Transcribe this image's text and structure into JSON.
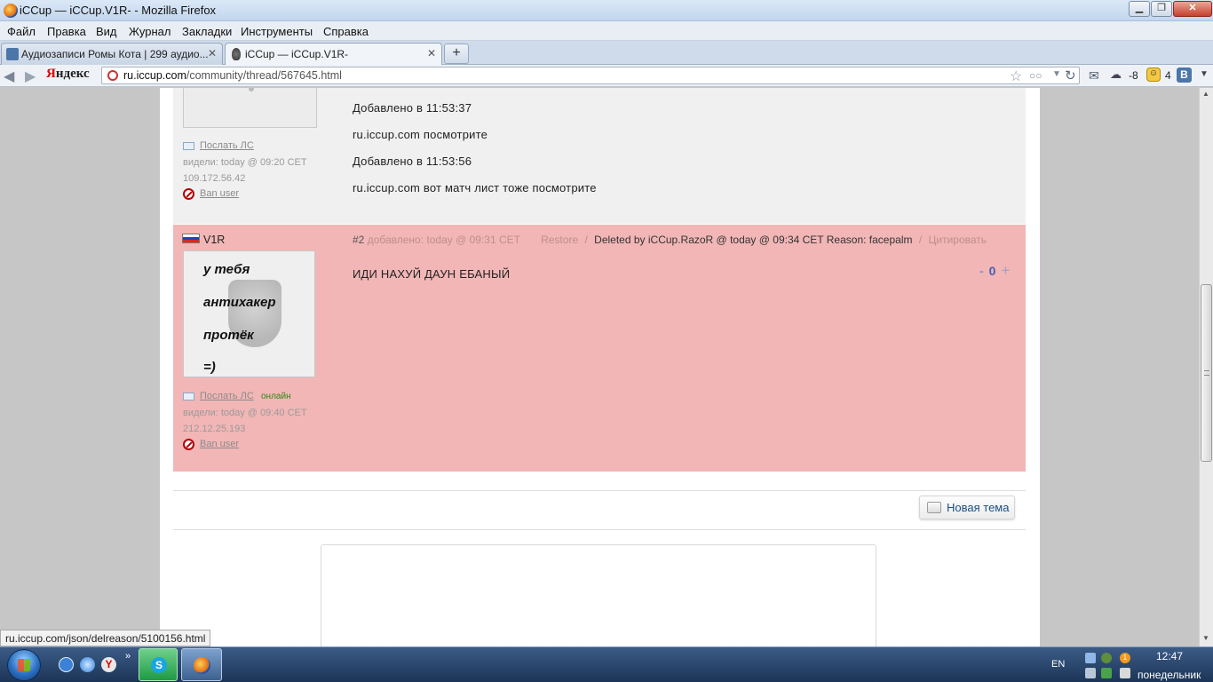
{
  "window": {
    "title": "iCCup — iCCup.V1R- - Mozilla Firefox",
    "min_glyph": "▁",
    "max_glyph": "❐",
    "close_glyph": "✕"
  },
  "menu": [
    "Файл",
    "Правка",
    "Вид",
    "Журнал",
    "Закладки",
    "Инструменты",
    "Справка"
  ],
  "tabs": [
    {
      "label": "Аудиозаписи Ромы Кота | 299 аудио...",
      "active": false
    },
    {
      "label": "iCCup — iCCup.V1R-",
      "active": true
    }
  ],
  "tab_close_glyph": "✕",
  "new_tab_glyph": "+",
  "nav": {
    "back_glyph": "◀",
    "fwd_glyph": "▶",
    "yandex_first": "Я",
    "yandex_rest": "ндекс",
    "url_domain": "ru.iccup.com",
    "url_path": "/community/thread/567645.html",
    "weather": "-8",
    "notification_count": "4",
    "vk": "В"
  },
  "post1": {
    "send_pm": "Послать ЛС",
    "seen": "видели: today @ 09:20 CET",
    "ip": "109.172.56.42",
    "ban": "Ban user",
    "lines": [
      "Добавлено в 11:53:37",
      "ru.iccup.com посмотрите",
      "Добавлено в 11:53:56",
      "ru.iccup.com вот матч лист тоже посмотрите"
    ]
  },
  "post2": {
    "username": "V1R",
    "avatar_text": [
      "у тебя",
      "антихакер",
      "протёк",
      "=)"
    ],
    "send_pm": "Послать ЛС",
    "online": "онлайн",
    "seen": "видели: today @ 09:40 CET",
    "ip": "212.12.25.193",
    "ban": "Ban user",
    "number": "#2",
    "added": "добавлено: today @ 09:31 CET",
    "restore": "Restore",
    "sep": "/",
    "deleted_by": "Deleted by iCCup.RazoR @ today @ 09:34 CET Reason: facepalm",
    "quote": "Цитировать",
    "message": "ИДИ НАХУЙ ДАУН ЕБАНЫЙ",
    "vote_minus": "-",
    "score": "0",
    "vote_plus": "+"
  },
  "new_topic": "Новая тема",
  "status_url": "ru.iccup.com/json/delreason/5100156.html",
  "taskbar": {
    "lang": "EN",
    "time": "12:47",
    "day": "понедельник",
    "more": "»",
    "skype_letter": "S",
    "yandex_letter": "Y",
    "tray_badge": "1"
  },
  "colors": {
    "deleted_post_bg": "#f2b6b6",
    "normal_post_bg": "#f0f0f0",
    "link_blue": "#1b4e82",
    "online_green": "#2a8a12"
  }
}
